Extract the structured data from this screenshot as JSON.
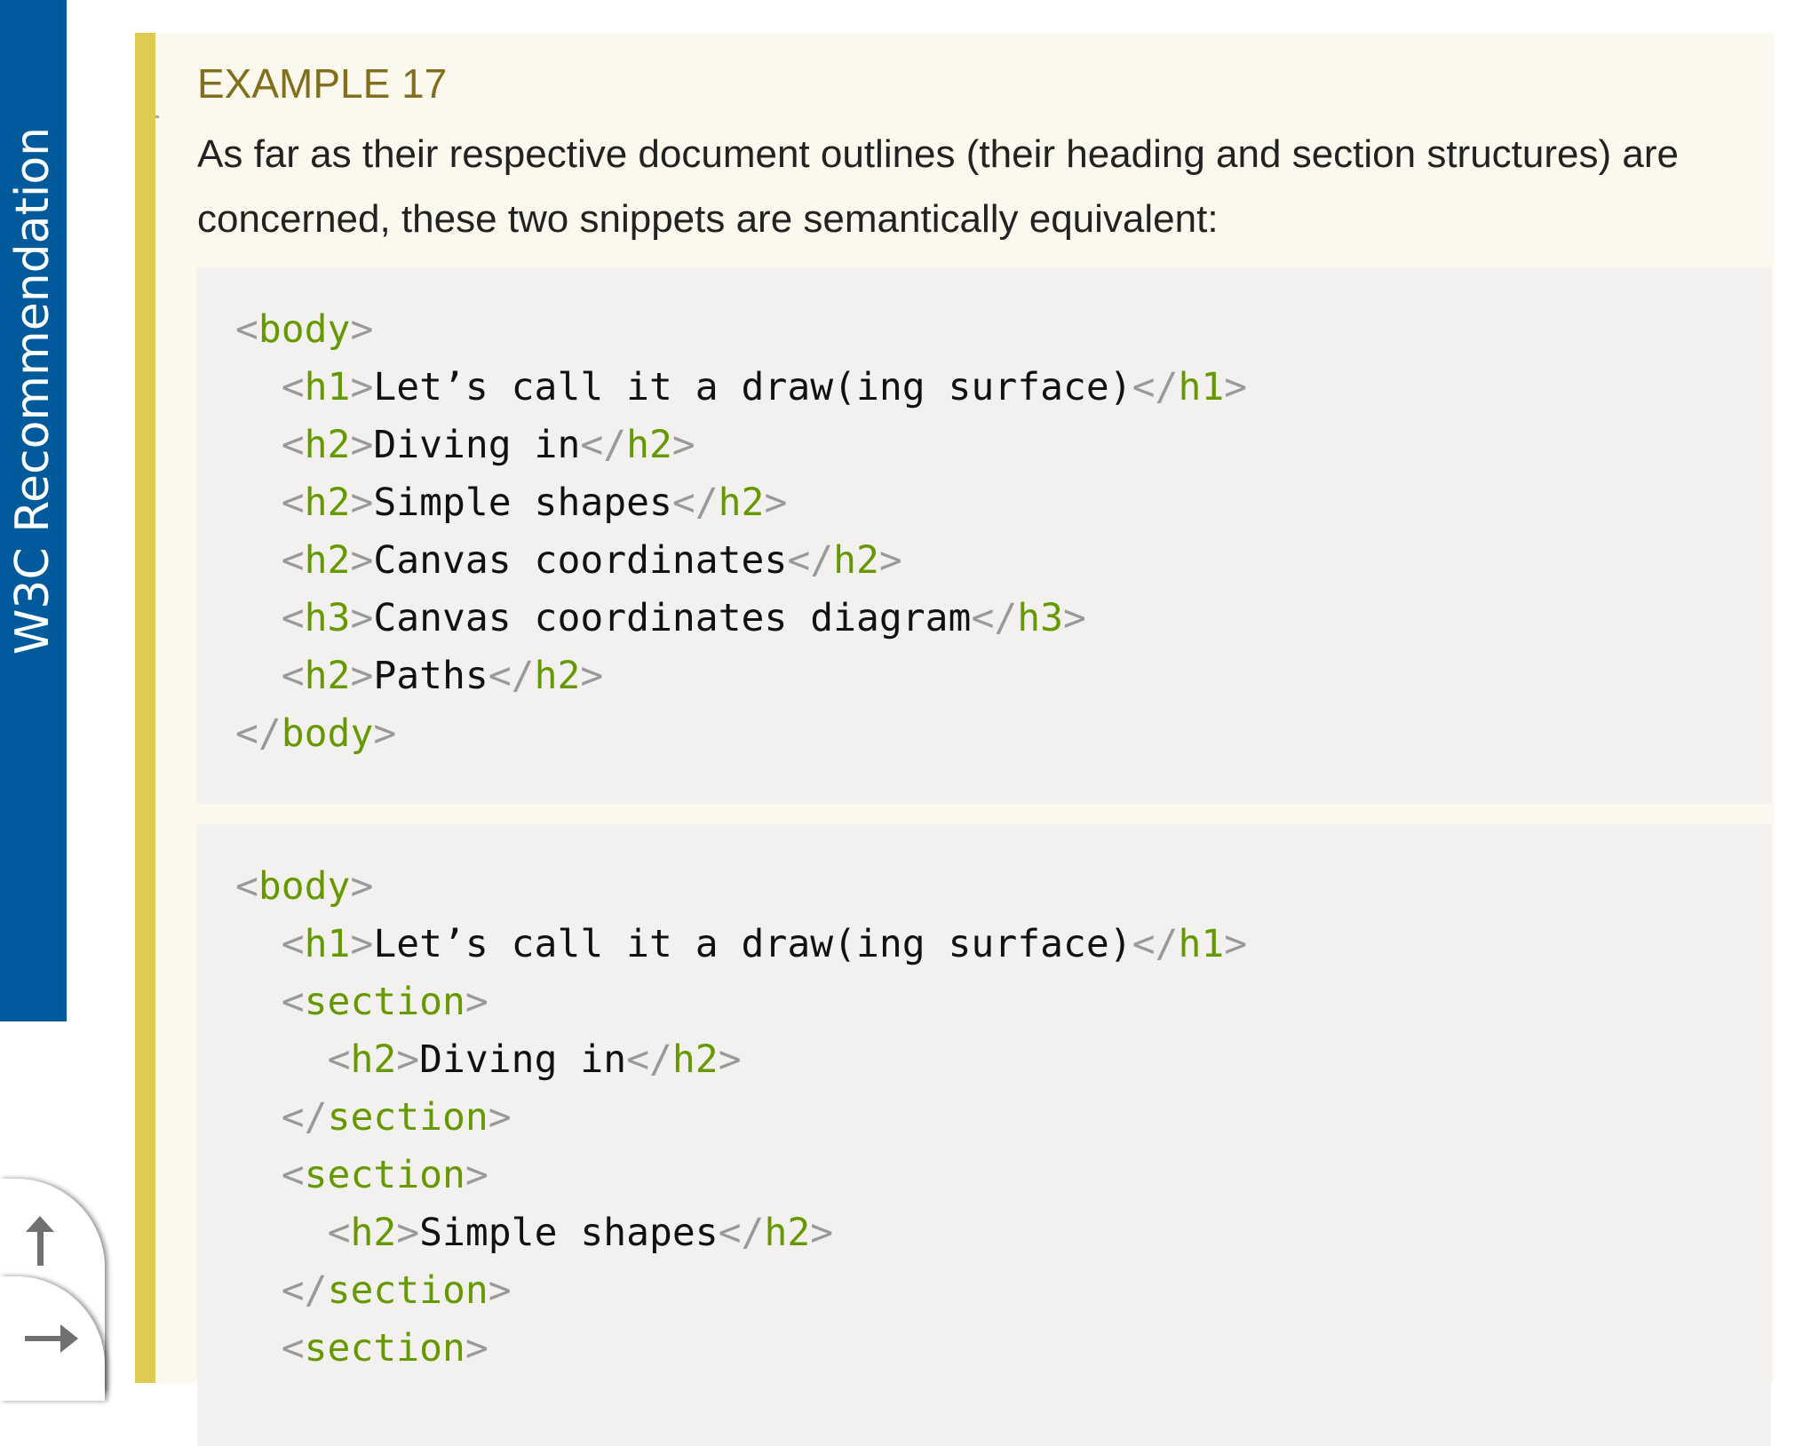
{
  "sidebar": {
    "label": "W3C Recommendation"
  },
  "example": {
    "title": "EXAMPLE 17",
    "text": "As far as their respective document outlines (their heading and section structures) are concerned, these two snippets are semantically equivalent:",
    "snippets": [
      [
        [
          [
            "p",
            "<"
          ],
          [
            "t",
            "body"
          ],
          [
            "p",
            ">"
          ]
        ],
        [
          [
            "x",
            "  "
          ],
          [
            "p",
            "<"
          ],
          [
            "t",
            "h1"
          ],
          [
            "p",
            ">"
          ],
          [
            "x",
            "Let’s call it a draw(ing surface)"
          ],
          [
            "p",
            "</"
          ],
          [
            "t",
            "h1"
          ],
          [
            "p",
            ">"
          ]
        ],
        [
          [
            "x",
            "  "
          ],
          [
            "p",
            "<"
          ],
          [
            "t",
            "h2"
          ],
          [
            "p",
            ">"
          ],
          [
            "x",
            "Diving in"
          ],
          [
            "p",
            "</"
          ],
          [
            "t",
            "h2"
          ],
          [
            "p",
            ">"
          ]
        ],
        [
          [
            "x",
            "  "
          ],
          [
            "p",
            "<"
          ],
          [
            "t",
            "h2"
          ],
          [
            "p",
            ">"
          ],
          [
            "x",
            "Simple shapes"
          ],
          [
            "p",
            "</"
          ],
          [
            "t",
            "h2"
          ],
          [
            "p",
            ">"
          ]
        ],
        [
          [
            "x",
            "  "
          ],
          [
            "p",
            "<"
          ],
          [
            "t",
            "h2"
          ],
          [
            "p",
            ">"
          ],
          [
            "x",
            "Canvas coordinates"
          ],
          [
            "p",
            "</"
          ],
          [
            "t",
            "h2"
          ],
          [
            "p",
            ">"
          ]
        ],
        [
          [
            "x",
            "  "
          ],
          [
            "p",
            "<"
          ],
          [
            "t",
            "h3"
          ],
          [
            "p",
            ">"
          ],
          [
            "x",
            "Canvas coordinates diagram"
          ],
          [
            "p",
            "</"
          ],
          [
            "t",
            "h3"
          ],
          [
            "p",
            ">"
          ]
        ],
        [
          [
            "x",
            "  "
          ],
          [
            "p",
            "<"
          ],
          [
            "t",
            "h2"
          ],
          [
            "p",
            ">"
          ],
          [
            "x",
            "Paths"
          ],
          [
            "p",
            "</"
          ],
          [
            "t",
            "h2"
          ],
          [
            "p",
            ">"
          ]
        ],
        [
          [
            "p",
            "</"
          ],
          [
            "t",
            "body"
          ],
          [
            "p",
            ">"
          ]
        ]
      ],
      [
        [
          [
            "p",
            "<"
          ],
          [
            "t",
            "body"
          ],
          [
            "p",
            ">"
          ]
        ],
        [
          [
            "x",
            "  "
          ],
          [
            "p",
            "<"
          ],
          [
            "t",
            "h1"
          ],
          [
            "p",
            ">"
          ],
          [
            "x",
            "Let’s call it a draw(ing surface)"
          ],
          [
            "p",
            "</"
          ],
          [
            "t",
            "h1"
          ],
          [
            "p",
            ">"
          ]
        ],
        [
          [
            "x",
            "  "
          ],
          [
            "p",
            "<"
          ],
          [
            "t",
            "section"
          ],
          [
            "p",
            ">"
          ]
        ],
        [
          [
            "x",
            "    "
          ],
          [
            "p",
            "<"
          ],
          [
            "t",
            "h2"
          ],
          [
            "p",
            ">"
          ],
          [
            "x",
            "Diving in"
          ],
          [
            "p",
            "</"
          ],
          [
            "t",
            "h2"
          ],
          [
            "p",
            ">"
          ]
        ],
        [
          [
            "x",
            "  "
          ],
          [
            "p",
            "</"
          ],
          [
            "t",
            "section"
          ],
          [
            "p",
            ">"
          ]
        ],
        [
          [
            "x",
            "  "
          ],
          [
            "p",
            "<"
          ],
          [
            "t",
            "section"
          ],
          [
            "p",
            ">"
          ]
        ],
        [
          [
            "x",
            "    "
          ],
          [
            "p",
            "<"
          ],
          [
            "t",
            "h2"
          ],
          [
            "p",
            ">"
          ],
          [
            "x",
            "Simple shapes"
          ],
          [
            "p",
            "</"
          ],
          [
            "t",
            "h2"
          ],
          [
            "p",
            ">"
          ]
        ],
        [
          [
            "x",
            "  "
          ],
          [
            "p",
            "</"
          ],
          [
            "t",
            "section"
          ],
          [
            "p",
            ">"
          ]
        ],
        [
          [
            "x",
            "  "
          ],
          [
            "p",
            "<"
          ],
          [
            "t",
            "section"
          ],
          [
            "p",
            ">"
          ]
        ]
      ]
    ]
  },
  "nav": {
    "up_icon": "arrow-up-icon",
    "next_icon": "arrow-right-icon"
  }
}
